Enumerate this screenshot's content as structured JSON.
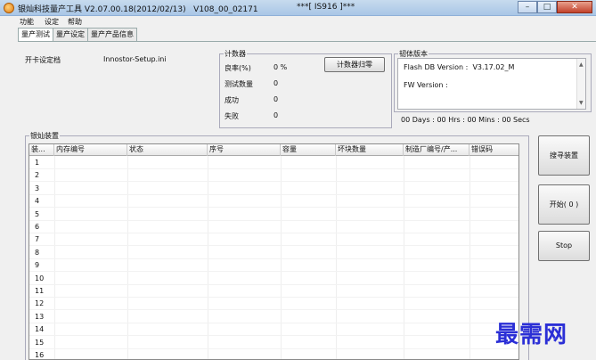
{
  "window": {
    "title": "银灿科技量产工具 V2.07.00.18(2012/02/13)   V108_00_02171",
    "title_mid": "***[ IS916 ]***",
    "controls": [
      "–",
      "□",
      "✕"
    ]
  },
  "menu": [
    "功能",
    "设定",
    "帮助"
  ],
  "tabs": [
    "量产测试",
    "量产设定",
    "量产产品信息"
  ],
  "setting_file": {
    "label": "开卡设定档",
    "value": "Innostor-Setup.ini"
  },
  "counter": {
    "title": "计数器",
    "reset_button": "计数器归零",
    "rows": [
      {
        "label": "良率(%)",
        "value": "0 %"
      },
      {
        "label": "测试数量",
        "value": "0"
      },
      {
        "label": "成功",
        "value": "0"
      },
      {
        "label": "失败",
        "value": "0"
      }
    ]
  },
  "firmware": {
    "title": "韧体版本",
    "lines": [
      "Flash DB Version :  V3.17.02_M",
      "FW Version :"
    ],
    "elapsed": "00 Days : 00 Hrs : 00 Mins : 00 Secs"
  },
  "devices": {
    "title": "银灿装置",
    "columns": [
      "装...",
      "内存编号",
      "状态",
      "序号",
      "容量",
      "坏块数量",
      "制造厂编号/产...",
      "错误码"
    ],
    "rows": [
      "1",
      "2",
      "3",
      "4",
      "5",
      "6",
      "7",
      "8",
      "9",
      "10",
      "11",
      "12",
      "13",
      "14",
      "15",
      "16"
    ]
  },
  "side_buttons": {
    "search": "搜寻装置",
    "start": "开始( 0 )",
    "stop": "Stop"
  },
  "watermark": "最需网"
}
